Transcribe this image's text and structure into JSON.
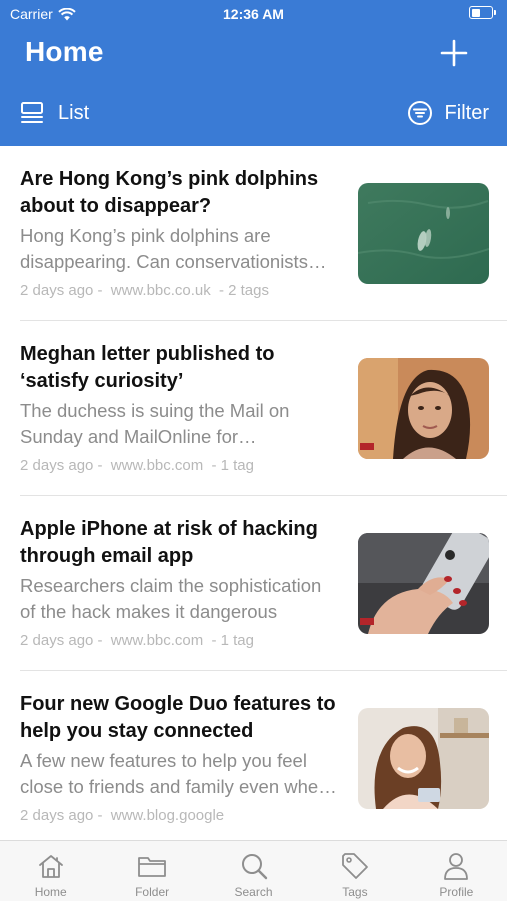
{
  "status_bar": {
    "carrier": "Carrier",
    "time": "12:36 AM"
  },
  "header": {
    "title": "Home",
    "list_label": "List",
    "filter_label": "Filter",
    "background": "#3a7bd5"
  },
  "articles": [
    {
      "title": "Are Hong Kong’s pink dolphins about to disappear?",
      "summary": "Hong Kong’s pink dolphins are disappearing. Can conservationists save them?",
      "time": "2 days ago -",
      "source": "www.bbc.co.uk",
      "tags": "- 2 tags",
      "image": "dolphins-water-photo"
    },
    {
      "title": "Meghan letter published to ‘satisfy curiosity’",
      "summary": "The duchess is suing the Mail on Sunday and MailOnline for reproducing the letter",
      "time": "2 days ago -",
      "source": "www.bbc.com",
      "tags": "- 1 tag",
      "image": "duchess-portrait-photo"
    },
    {
      "title": "Apple iPhone at risk of hacking through email app",
      "summary": "Researchers claim the sophistication of the hack makes it dangerous",
      "time": "2 days ago -",
      "source": "www.bbc.com",
      "tags": "- 1 tag",
      "image": "hand-holding-iphone-photo"
    },
    {
      "title": "Four new Google Duo features to help you stay connected",
      "summary": "A few new features to help you feel close to friends and family even when apart",
      "time": "2 days ago -",
      "source": "www.blog.google",
      "tags": "",
      "image": "woman-video-call-photo"
    }
  ],
  "tabbar": {
    "tabs": [
      {
        "label": "Home",
        "icon": "home-icon"
      },
      {
        "label": "Folder",
        "icon": "folder-icon"
      },
      {
        "label": "Search",
        "icon": "search-icon"
      },
      {
        "label": "Tags",
        "icon": "tag-icon"
      },
      {
        "label": "Profile",
        "icon": "person-icon"
      }
    ]
  }
}
